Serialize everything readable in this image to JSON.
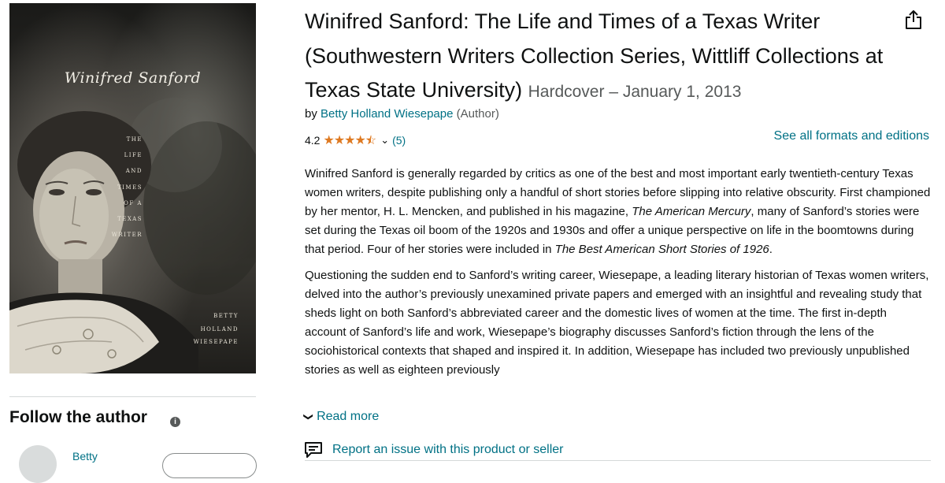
{
  "cover": {
    "title": "Winifred Sanford",
    "subtitle_lines": [
      "THE",
      "LIFE",
      "AND",
      "TIMES",
      "OF A",
      "TEXAS",
      "WRITER"
    ],
    "author_lines": [
      "BETTY",
      "HOLLAND",
      "WIESEPAPE"
    ]
  },
  "product": {
    "title": "Winifred Sanford: The Life and Times of a Texas Writer (Southwestern Writers Collection Series, Wittliff Collections at Texas State University)",
    "format": "Hardcover – January 1, 2013",
    "by_label": "by",
    "author": "Betty Holland Wiesepape",
    "author_role": "(Author)",
    "rating": "4.2",
    "rating_value": 4.2,
    "rating_count": "(5)",
    "formats_link": "See all formats and editions"
  },
  "description": {
    "p1_a": "Winifred Sanford is generally regarded by critics as one of the best and most important early twentieth-century Texas women writers, despite publishing only a handful of short stories before slipping into relative obscurity. First championed by her mentor, H. L. Mencken, and published in his magazine, ",
    "p1_em1": "The American Mercury",
    "p1_b": ", many of Sanford’s stories were set during the Texas oil boom of the 1920s and 1930s and offer a unique perspective on life in the boomtowns during that period. Four of her stories were included in ",
    "p1_em2": "The Best American Short Stories of 1926",
    "p1_c": ".",
    "p2": "Questioning the sudden end to Sanford’s writing career, Wiesepape, a leading literary historian of Texas women writers, delved into the author’s previously unexamined private papers and emerged with an insightful and revealing study that sheds light on both Sanford’s abbreviated career and the domestic lives of women at the time. The first in-depth account of Sanford’s life and work, Wiesepape’s biography discusses Sanford’s fiction through the lens of the sociohistorical contexts that shaped and inspired it. In addition, Wiesepape has included two previously unpublished stories as well as eighteen previously",
    "read_more": "Read more"
  },
  "report": {
    "label": "Report an issue with this product or seller"
  },
  "follow": {
    "title": "Follow the author",
    "author_short": "Betty"
  },
  "colors": {
    "link": "#007185",
    "star": "#de7921",
    "text": "#0f1111",
    "muted": "#565959"
  }
}
